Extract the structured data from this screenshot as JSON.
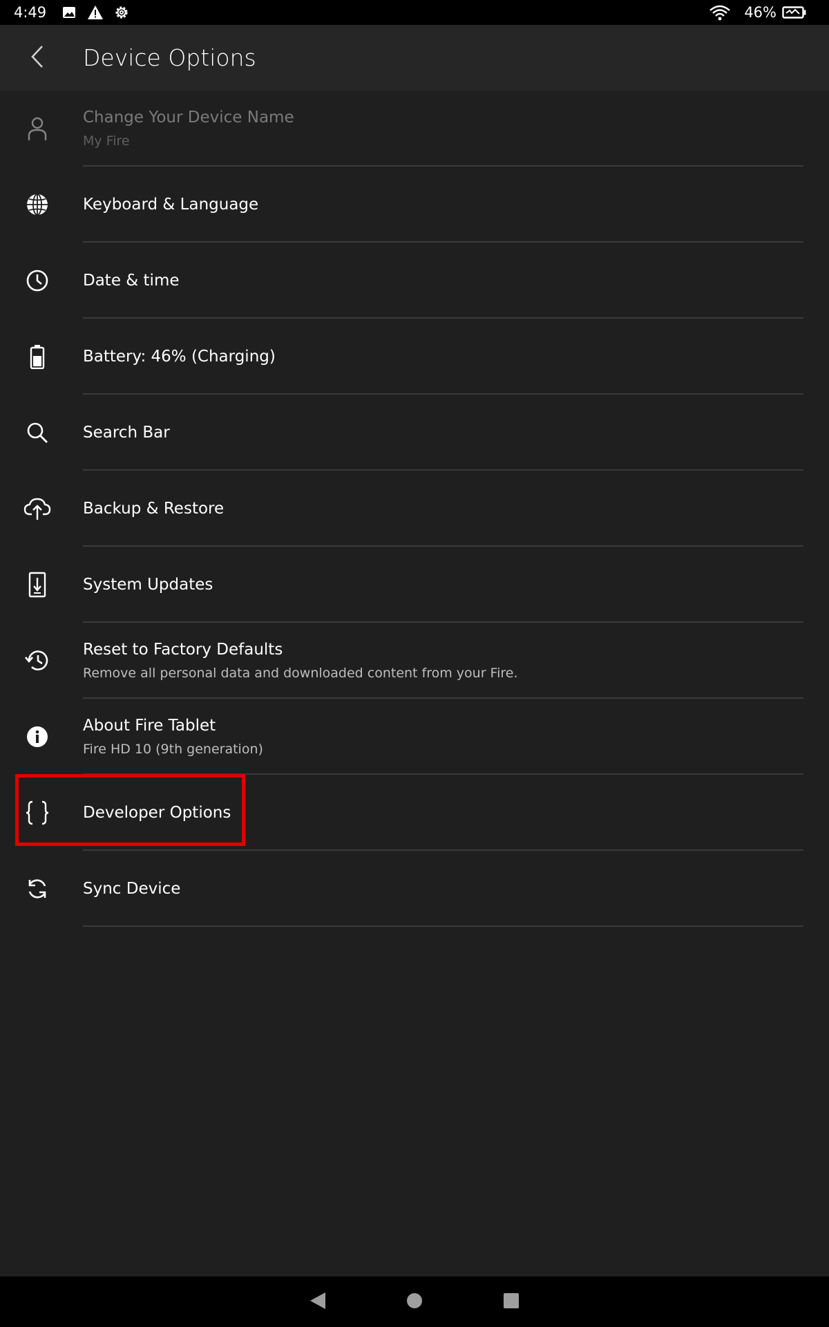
{
  "status_bar": {
    "time": "4:49",
    "battery_percent": "46%",
    "icons": [
      "image-icon",
      "warning-icon",
      "settings-icon",
      "wifi-icon",
      "battery-charging-icon"
    ]
  },
  "header": {
    "title": "Device Options",
    "back_icon": "back-arrow-icon"
  },
  "items": [
    {
      "label": "Change Your Device Name",
      "sub": "My Fire",
      "icon": "person-icon",
      "disabled": true
    },
    {
      "label": "Keyboard  & Language",
      "icon": "globe-icon"
    },
    {
      "label": "Date & time",
      "icon": "clock-icon"
    },
    {
      "label": "Battery: 46% (Charging)",
      "icon": "battery-icon"
    },
    {
      "label": "Search Bar",
      "icon": "search-icon"
    },
    {
      "label": "Backup & Restore",
      "icon": "cloud-upload-icon"
    },
    {
      "label": "System Updates",
      "icon": "system-update-icon"
    },
    {
      "label": "Reset to Factory Defaults",
      "sub": "Remove all personal data and downloaded content from your Fire.",
      "icon": "history-icon"
    },
    {
      "label": "About Fire Tablet",
      "sub": "Fire HD 10 (9th generation)",
      "icon": "info-icon"
    },
    {
      "label": "Developer Options",
      "icon": "curly-braces-icon"
    },
    {
      "label": "Sync Device",
      "icon": "sync-icon"
    }
  ],
  "highlight": {
    "target": "Developer Options",
    "color": "#e00000"
  },
  "colors": {
    "background": "#1f1f1f",
    "appbar": "#262626",
    "divider": "#3a3a3a",
    "highlight": "#e00000"
  },
  "nav_bar": {
    "icons": [
      "nav-back-icon",
      "nav-home-icon",
      "nav-recents-icon"
    ]
  }
}
